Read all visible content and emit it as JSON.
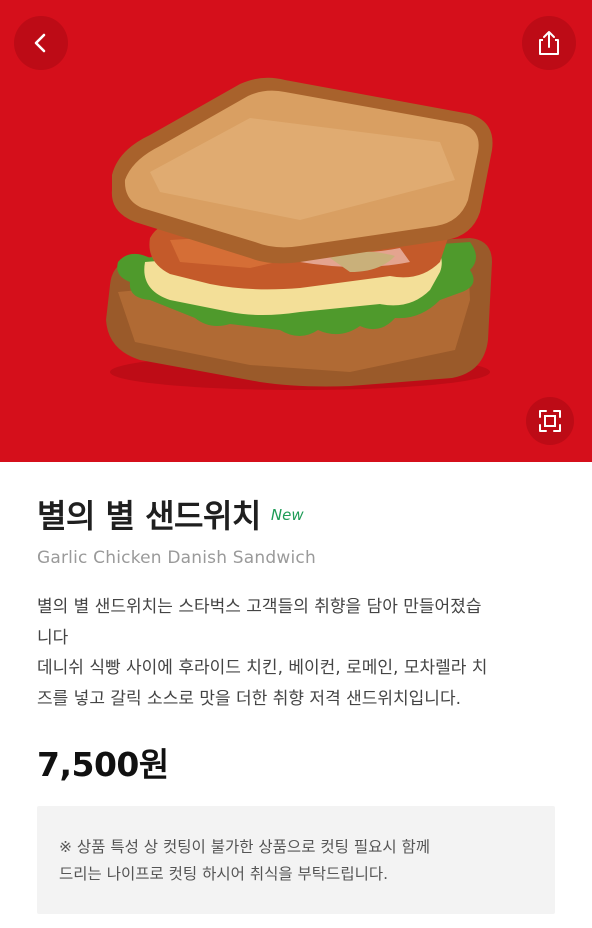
{
  "hero": {
    "background_color": "#d50f1b",
    "image_subject": "sandwich-photo"
  },
  "toolbar": {
    "back_icon": "chevron-left-icon",
    "share_icon": "share-icon",
    "zoom_icon": "fullscreen-icon"
  },
  "product": {
    "name": "별의 별 샌드위치",
    "badge": "New",
    "english_name": "Garlic Chicken Danish Sandwich",
    "description_lines": [
      "별의 별 샌드위치는 스타벅스 고객들의 취향을 담아 만들어졌습",
      "니다",
      "데니쉬 식빵 사이에 후라이드 치킨, 베이컨, 로메인, 모차렐라 치",
      "즈를 넣고 갈릭 소스로 맛을 더한 취향 저격 샌드위치입니다."
    ],
    "price": "7,500원",
    "notice_lines": [
      "※ 상품 특성 상 컷팅이 불가한 상품으로 컷팅 필요시 함께",
      "드리는 나이프로 컷팅 하시어 취식을 부탁드립니다."
    ]
  },
  "colors": {
    "accent_new": "#1f9c57",
    "hero_red": "#d50f1b"
  }
}
